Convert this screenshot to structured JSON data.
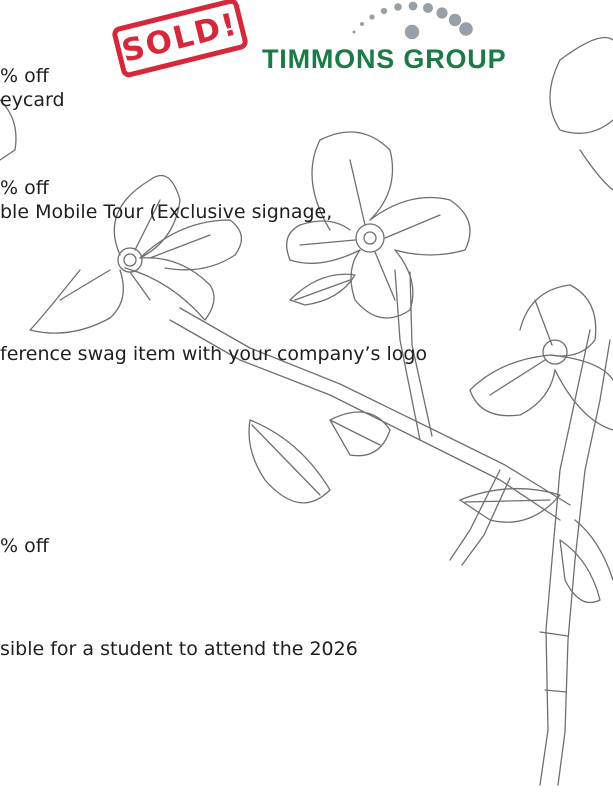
{
  "colors": {
    "text": "#1f1f1f",
    "stamp_red": "#d6283a",
    "brand_green": "#1b7a45",
    "logo_gray": "#97a0a6",
    "line_art": "#6f6f6f"
  },
  "lines": [
    "% off",
    "eycard",
    "% off",
    "ble Mobile Tour (Exclusive signage,",
    "ference swag item with your company’s logo",
    "% off",
    "sible for a student to attend the 2026"
  ],
  "stamp": {
    "text": "SOLD!"
  },
  "logo": {
    "name": "TIMMONS GROUP",
    "icon": "dotted-arc-logo-icon"
  },
  "decoration": {
    "icon": "dogwood-flower-branch-illustration"
  }
}
